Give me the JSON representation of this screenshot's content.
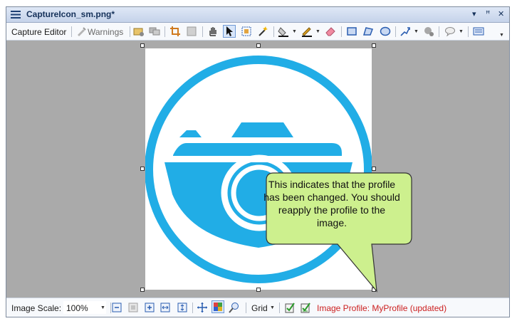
{
  "window": {
    "title": "CaptureIcon_sm.png*",
    "controls": {
      "dropdown": "▾",
      "pin": "ꟸ",
      "close": "✕"
    }
  },
  "toolbar": {
    "capture_editor_label": "Capture Editor",
    "warnings_label": "Warnings"
  },
  "callout": {
    "text": "This indicates that the profile has been changed. You should reapply the profile to the image."
  },
  "statusbar": {
    "image_scale_label": "Image Scale:",
    "image_scale_value": "100%",
    "grid_label": "Grid",
    "profile_text": "Image Profile: MyProfile (updated)"
  },
  "colors": {
    "camera_blue": "#21ade6",
    "canvas_gray": "#aaaaaa",
    "callout_fill": "#cdf08e",
    "profile_red": "#cc1f1f"
  },
  "icons": [
    "menu-icon",
    "warnings-icon",
    "folder-icon",
    "screens-icon",
    "crop-icon",
    "frame-icon",
    "hand-icon",
    "arrow-cursor-icon",
    "select-region-icon",
    "magic-wand-icon",
    "fill-icon",
    "pen-icon",
    "eraser-icon",
    "rectangle-icon",
    "polygon-icon",
    "ellipse-icon",
    "line-arrow-icon",
    "gear-icon",
    "speech-bubble-icon",
    "text-box-icon",
    "zoom-out-icon",
    "zoom-actual-icon",
    "zoom-in-icon",
    "fit-width-icon",
    "fit-height-icon",
    "move-icon",
    "grid-color-icon",
    "zoom-select-icon",
    "apply-profile-icon",
    "check-profile-icon"
  ]
}
